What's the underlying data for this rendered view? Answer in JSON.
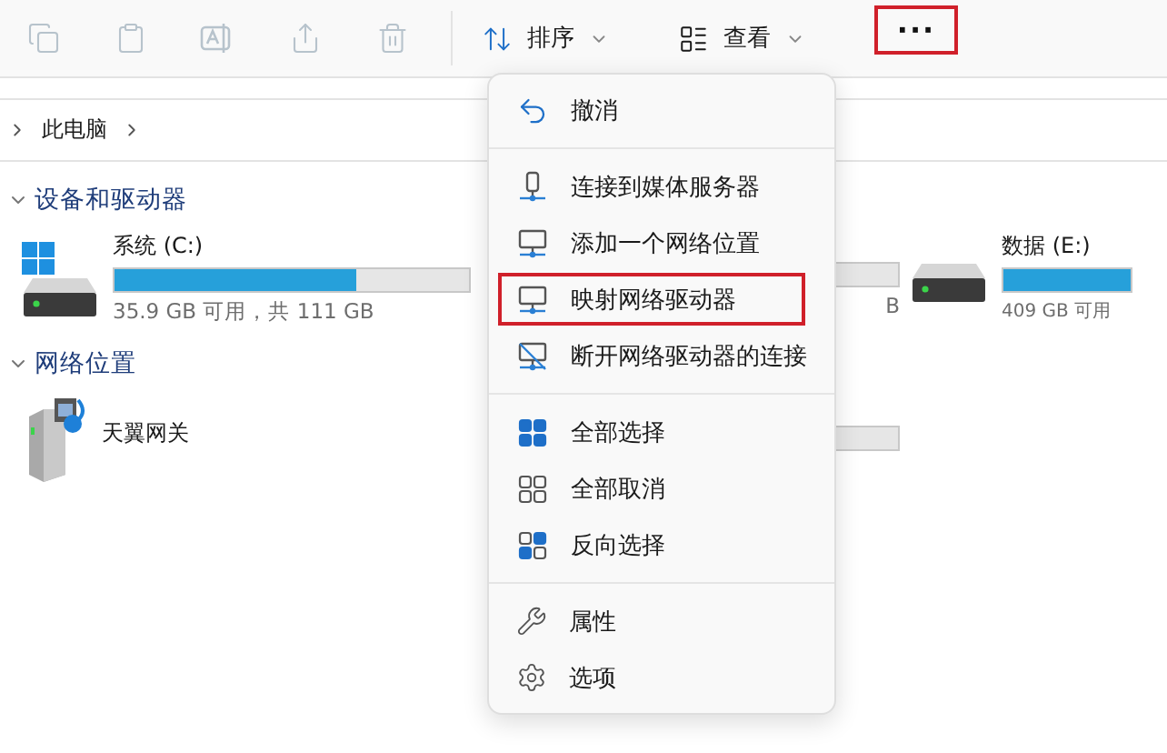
{
  "toolbar": {
    "buttons": [
      {
        "kind": "copy",
        "disabled": true
      },
      {
        "kind": "paste",
        "disabled": true
      },
      {
        "kind": "rename",
        "disabled": true
      },
      {
        "kind": "share",
        "disabled": true
      },
      {
        "kind": "delete",
        "disabled": true
      }
    ],
    "dropdowns": [
      {
        "kind": "sort",
        "label": "排序"
      },
      {
        "kind": "view",
        "label": "查看"
      }
    ],
    "more": {
      "label": "···",
      "highlighted": true
    }
  },
  "address_bar": {
    "path": [
      "此电脑"
    ]
  },
  "groups": [
    {
      "title": "设备和驱动器",
      "expanded": true,
      "items": [
        {
          "kind": "drive",
          "name": "系统 (C:)",
          "level": 0.68,
          "info": "35.9 GB 可用，共 111 GB"
        },
        {
          "kind": "partial-drive",
          "info": "B"
        },
        {
          "kind": "drive-edge",
          "name": "数据 (E:)",
          "level": 1,
          "info": "409 GB 可用"
        }
      ]
    },
    {
      "title": "网络位置",
      "expanded": true,
      "items": [
        {
          "kind": "gateway",
          "name": "天翼网关"
        },
        {
          "kind": "partial-drive"
        }
      ]
    }
  ],
  "menu": {
    "sections": [
      [
        {
          "kind": "undo",
          "label": "撤消",
          "highlighted": false
        }
      ],
      [
        {
          "kind": "media-server",
          "label": "连接到媒体服务器",
          "highlighted": false
        },
        {
          "kind": "network-location",
          "label": "添加一个网络位置",
          "highlighted": false
        },
        {
          "kind": "map-drive",
          "label": "映射网络驱动器",
          "highlighted": true
        },
        {
          "kind": "disconnect-drive",
          "label": "断开网络驱动器的连接",
          "highlighted": false
        }
      ],
      [
        {
          "kind": "select-all",
          "label": "全部选择",
          "highlighted": false
        },
        {
          "kind": "select-none",
          "label": "全部取消",
          "highlighted": false
        },
        {
          "kind": "invert-selection",
          "label": "反向选择",
          "highlighted": false
        }
      ],
      [
        {
          "kind": "properties",
          "label": "属性",
          "highlighted": false
        },
        {
          "kind": "options",
          "label": "选项",
          "highlighted": false
        }
      ]
    ]
  }
}
